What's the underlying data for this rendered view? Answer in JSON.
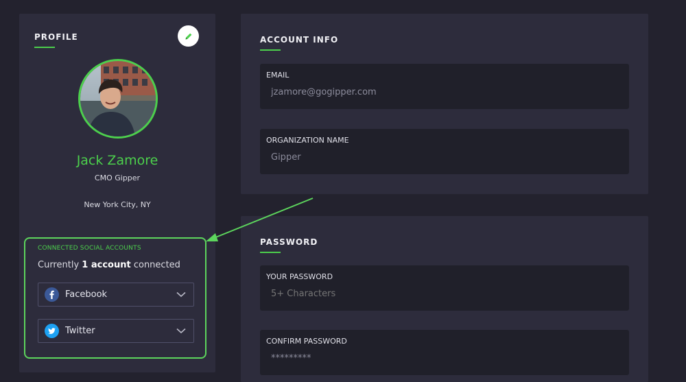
{
  "profile": {
    "section_title": "PROFILE",
    "name": "Jack Zamore",
    "role": "CMO Gipper",
    "location": "New York City, NY"
  },
  "social": {
    "title": "CONNECTED SOCIAL ACCOUNTS",
    "summary_prefix": "Currently",
    "summary_count": "1 account",
    "summary_suffix": "connected",
    "accounts": [
      {
        "label": "Facebook",
        "icon": "facebook-icon",
        "color": "#3b5998"
      },
      {
        "label": "Twitter",
        "icon": "twitter-icon",
        "color": "#1da1f2"
      }
    ]
  },
  "account_info": {
    "section_title": "ACCOUNT INFO",
    "email_label": "EMAIL",
    "email_value": "jzamore@gogipper.com",
    "org_label": "ORGANIZATION NAME",
    "org_value": "Gipper"
  },
  "password": {
    "section_title": "PASSWORD",
    "your_label": "YOUR PASSWORD",
    "your_placeholder": "5+ Characters",
    "confirm_label": "CONFIRM PASSWORD",
    "confirm_value": "*********"
  },
  "colors": {
    "accent": "#4cd04c",
    "background": "#23222e",
    "card": "#2d2c3c",
    "field": "#20202a"
  }
}
